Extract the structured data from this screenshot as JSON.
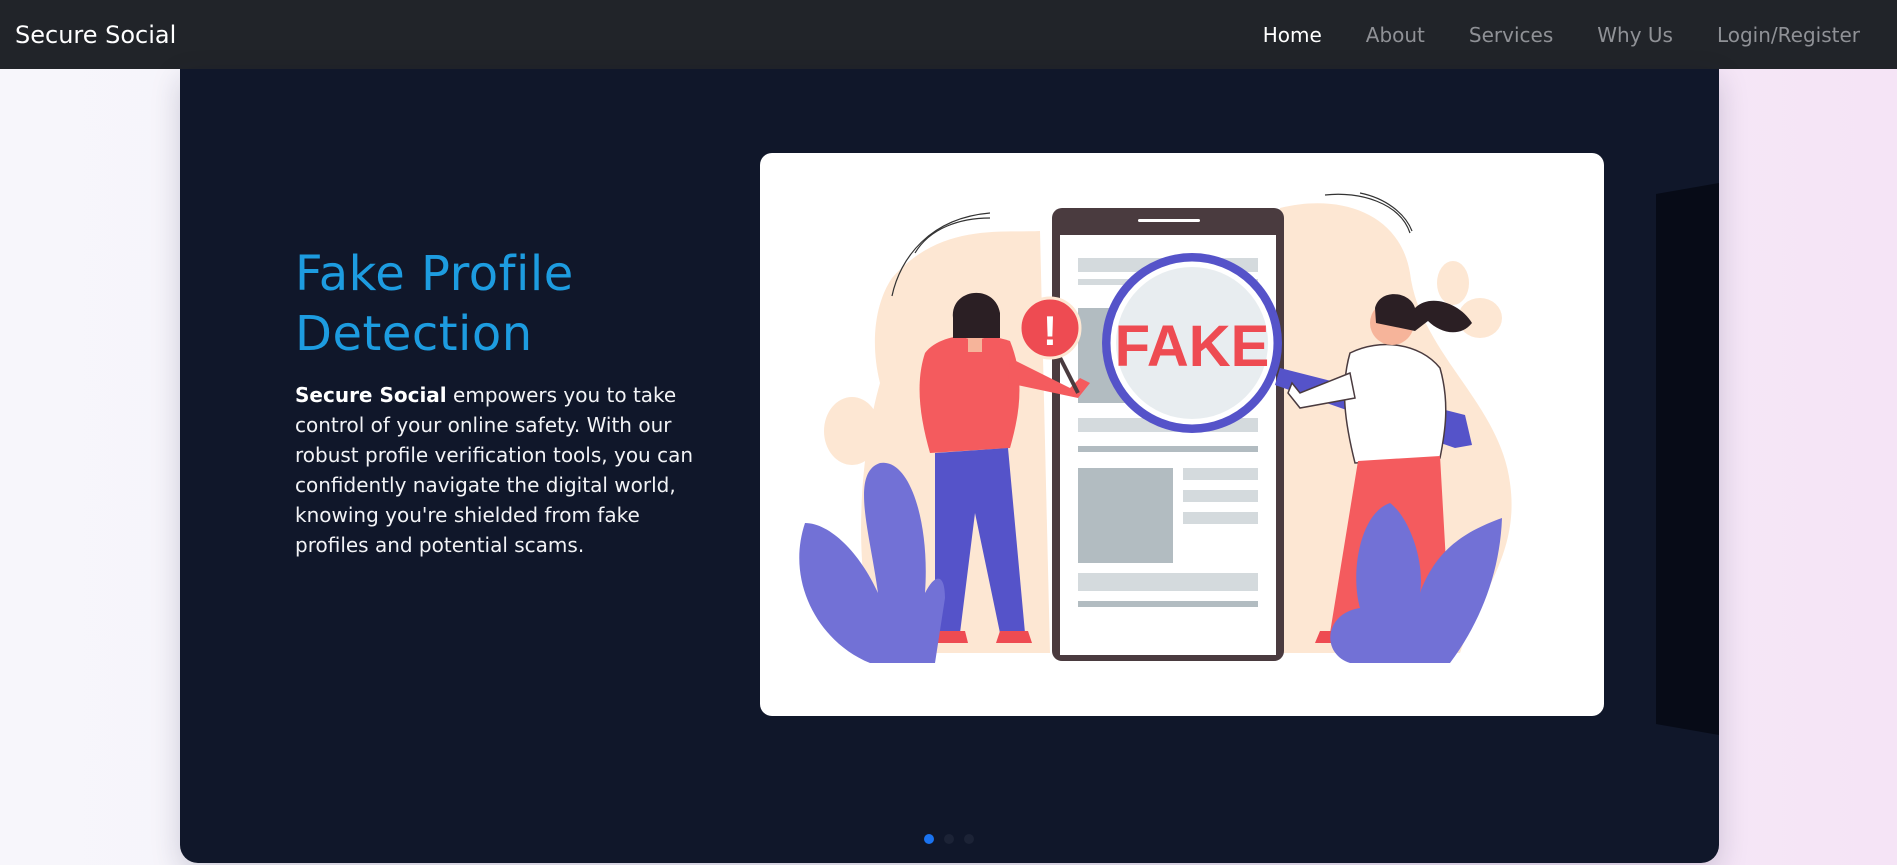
{
  "nav": {
    "brand": "Secure Social",
    "links": [
      {
        "label": "Home",
        "active": true
      },
      {
        "label": "About",
        "active": false
      },
      {
        "label": "Services",
        "active": false
      },
      {
        "label": "Why Us",
        "active": false
      },
      {
        "label": "Login/Register",
        "active": false
      }
    ]
  },
  "hero": {
    "title": "Fake Profile Detection",
    "desc_strong": "Secure Social",
    "desc_rest": " empowers you to take control of your online safety. With our robust profile verification tools, you can confidently navigate the digital world, knowing you're shielded from fake profiles and potential scams.",
    "illustration": {
      "icon": "fake-profile-magnifier-illustration",
      "stamp_text": "FAKE",
      "alert_symbol": "!"
    }
  },
  "carousel": {
    "slide_count": 3,
    "active_index": 0
  },
  "colors": {
    "navbar_bg": "#212429",
    "hero_bg": "#10172a",
    "title": "#1d9ce0",
    "indicator_active": "#1a73f0",
    "fake_red": "#ee4b52",
    "accent_purple": "#5553c9"
  }
}
